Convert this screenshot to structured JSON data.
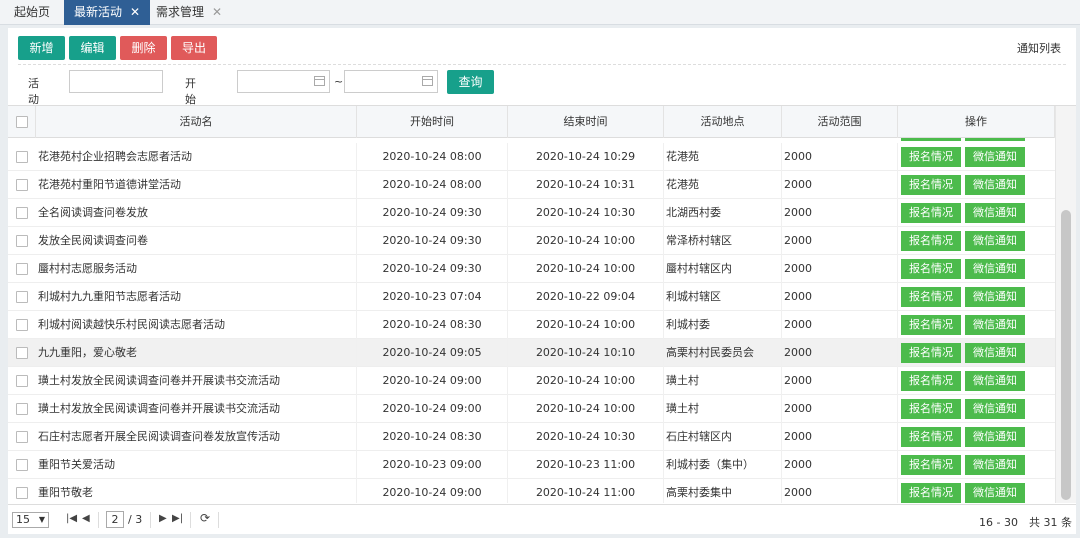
{
  "tabs": [
    {
      "label": "起始页",
      "closable": false,
      "active": false
    },
    {
      "label": "最新活动",
      "closable": true,
      "active": true
    },
    {
      "label": "需求管理",
      "closable": true,
      "active": false
    }
  ],
  "toolbar": {
    "add": "新增",
    "edit": "编辑",
    "delete": "删除",
    "export": "导出",
    "notice": "通知列表"
  },
  "filter": {
    "name_label": "活动名",
    "name_value": "",
    "start_label": "开始时间",
    "start_from": "",
    "start_to": "",
    "tilde": "~",
    "query": "查询"
  },
  "columns": {
    "name": "活动名",
    "start": "开始时间",
    "end": "结束时间",
    "place": "活动地点",
    "range": "活动范围",
    "ops": "操作"
  },
  "row_actions": {
    "signup": "报名情况",
    "wechat": "微信通知"
  },
  "rows": [
    {
      "name": "花港苑村企业招聘会志愿者活动",
      "start": "2020-10-24 08:00",
      "end": "2020-10-24 10:29",
      "place": "花港苑",
      "range": "2000"
    },
    {
      "name": "花港苑村重阳节道德讲堂活动",
      "start": "2020-10-24 08:00",
      "end": "2020-10-24 10:31",
      "place": "花港苑",
      "range": "2000"
    },
    {
      "name": "全名阅读调查问卷发放",
      "start": "2020-10-24 09:30",
      "end": "2020-10-24 10:30",
      "place": "北湖西村委",
      "range": "2000"
    },
    {
      "name": "发放全民阅读调查问卷",
      "start": "2020-10-24 09:30",
      "end": "2020-10-24 10:00",
      "place": "常泽桥村辖区",
      "range": "2000"
    },
    {
      "name": "蜃村村志愿服务活动",
      "start": "2020-10-24 09:30",
      "end": "2020-10-24 10:00",
      "place": "蜃村村辖区内",
      "range": "2000"
    },
    {
      "name": "利城村九九重阳节志愿者活动",
      "start": "2020-10-23 07:04",
      "end": "2020-10-22 09:04",
      "place": "利城村辖区",
      "range": "2000"
    },
    {
      "name": "利城村阅读越快乐村民阅读志愿者活动",
      "start": "2020-10-24 08:30",
      "end": "2020-10-24 10:00",
      "place": "利城村委",
      "range": "2000"
    },
    {
      "name": "九九重阳，爱心敬老",
      "start": "2020-10-24 09:05",
      "end": "2020-10-24 10:10",
      "place": "高栗村村民委员会",
      "range": "2000"
    },
    {
      "name": "璜土村发放全民阅读调查问卷并开展读书交流活动",
      "start": "2020-10-24 09:00",
      "end": "2020-10-24 10:00",
      "place": "璜土村",
      "range": "2000"
    },
    {
      "name": "璜土村发放全民阅读调查问卷并开展读书交流活动",
      "start": "2020-10-24 09:00",
      "end": "2020-10-24 10:00",
      "place": "璜土村",
      "range": "2000"
    },
    {
      "name": "石庄村志愿者开展全民阅读调查问卷发放宣传活动",
      "start": "2020-10-24 08:30",
      "end": "2020-10-24 10:30",
      "place": "石庄村辖区内",
      "range": "2000"
    },
    {
      "name": "重阳节关爱活动",
      "start": "2020-10-23 09:00",
      "end": "2020-10-23 11:00",
      "place": "利城村委（集中）",
      "range": "2000"
    },
    {
      "name": "重阳节敬老",
      "start": "2020-10-24 09:00",
      "end": "2020-10-24 11:00",
      "place": "高栗村委集中",
      "range": "2000"
    }
  ],
  "pager": {
    "page_size": "15",
    "current": "2",
    "total_pages": "/ 3",
    "info": "16 - 30　共 31 条"
  },
  "colors": {
    "tab_active": "#2f5f95",
    "teal": "#17a08b",
    "red": "#e05a5a",
    "green": "#4cbb4c"
  }
}
